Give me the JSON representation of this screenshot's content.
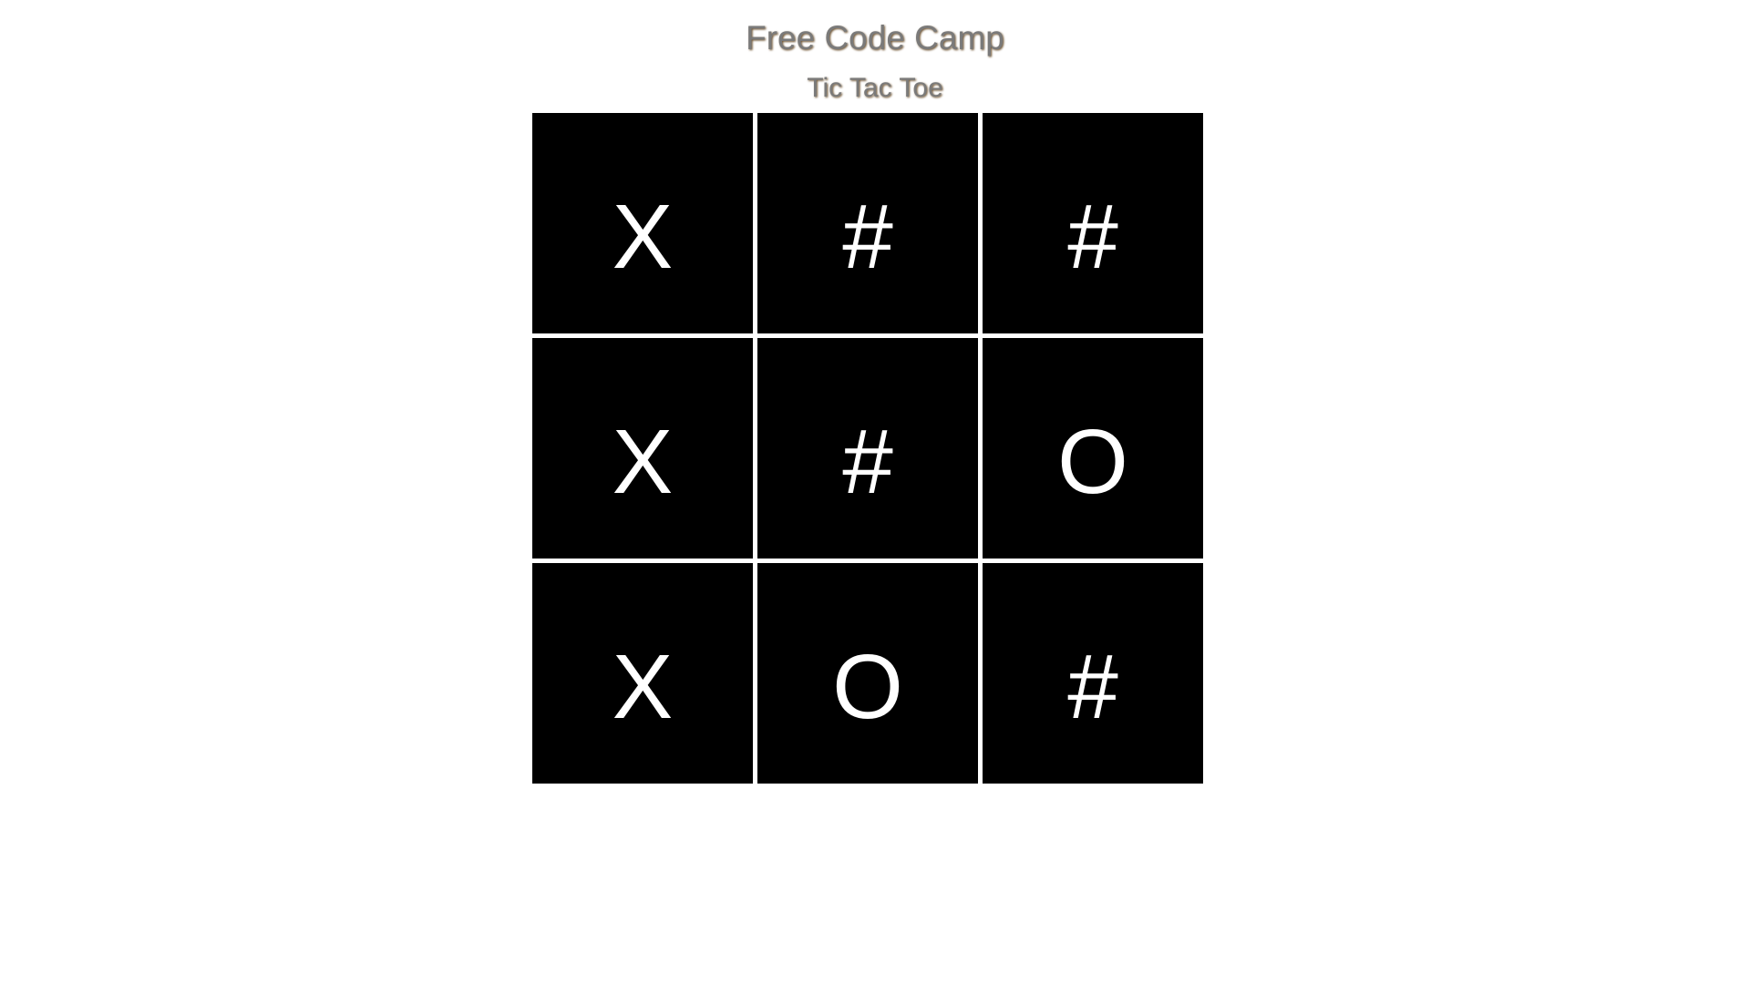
{
  "header": {
    "title": "Free Code Camp",
    "subtitle": "Tic Tac Toe"
  },
  "board": {
    "cells": [
      "X",
      "#",
      "#",
      "X",
      "#",
      "O",
      "X",
      "O",
      "#"
    ]
  },
  "colors": {
    "cell_background": "#000000",
    "cell_text": "#ffffff",
    "page_background": "#ffffff",
    "title_text": "#7a7a7a"
  }
}
